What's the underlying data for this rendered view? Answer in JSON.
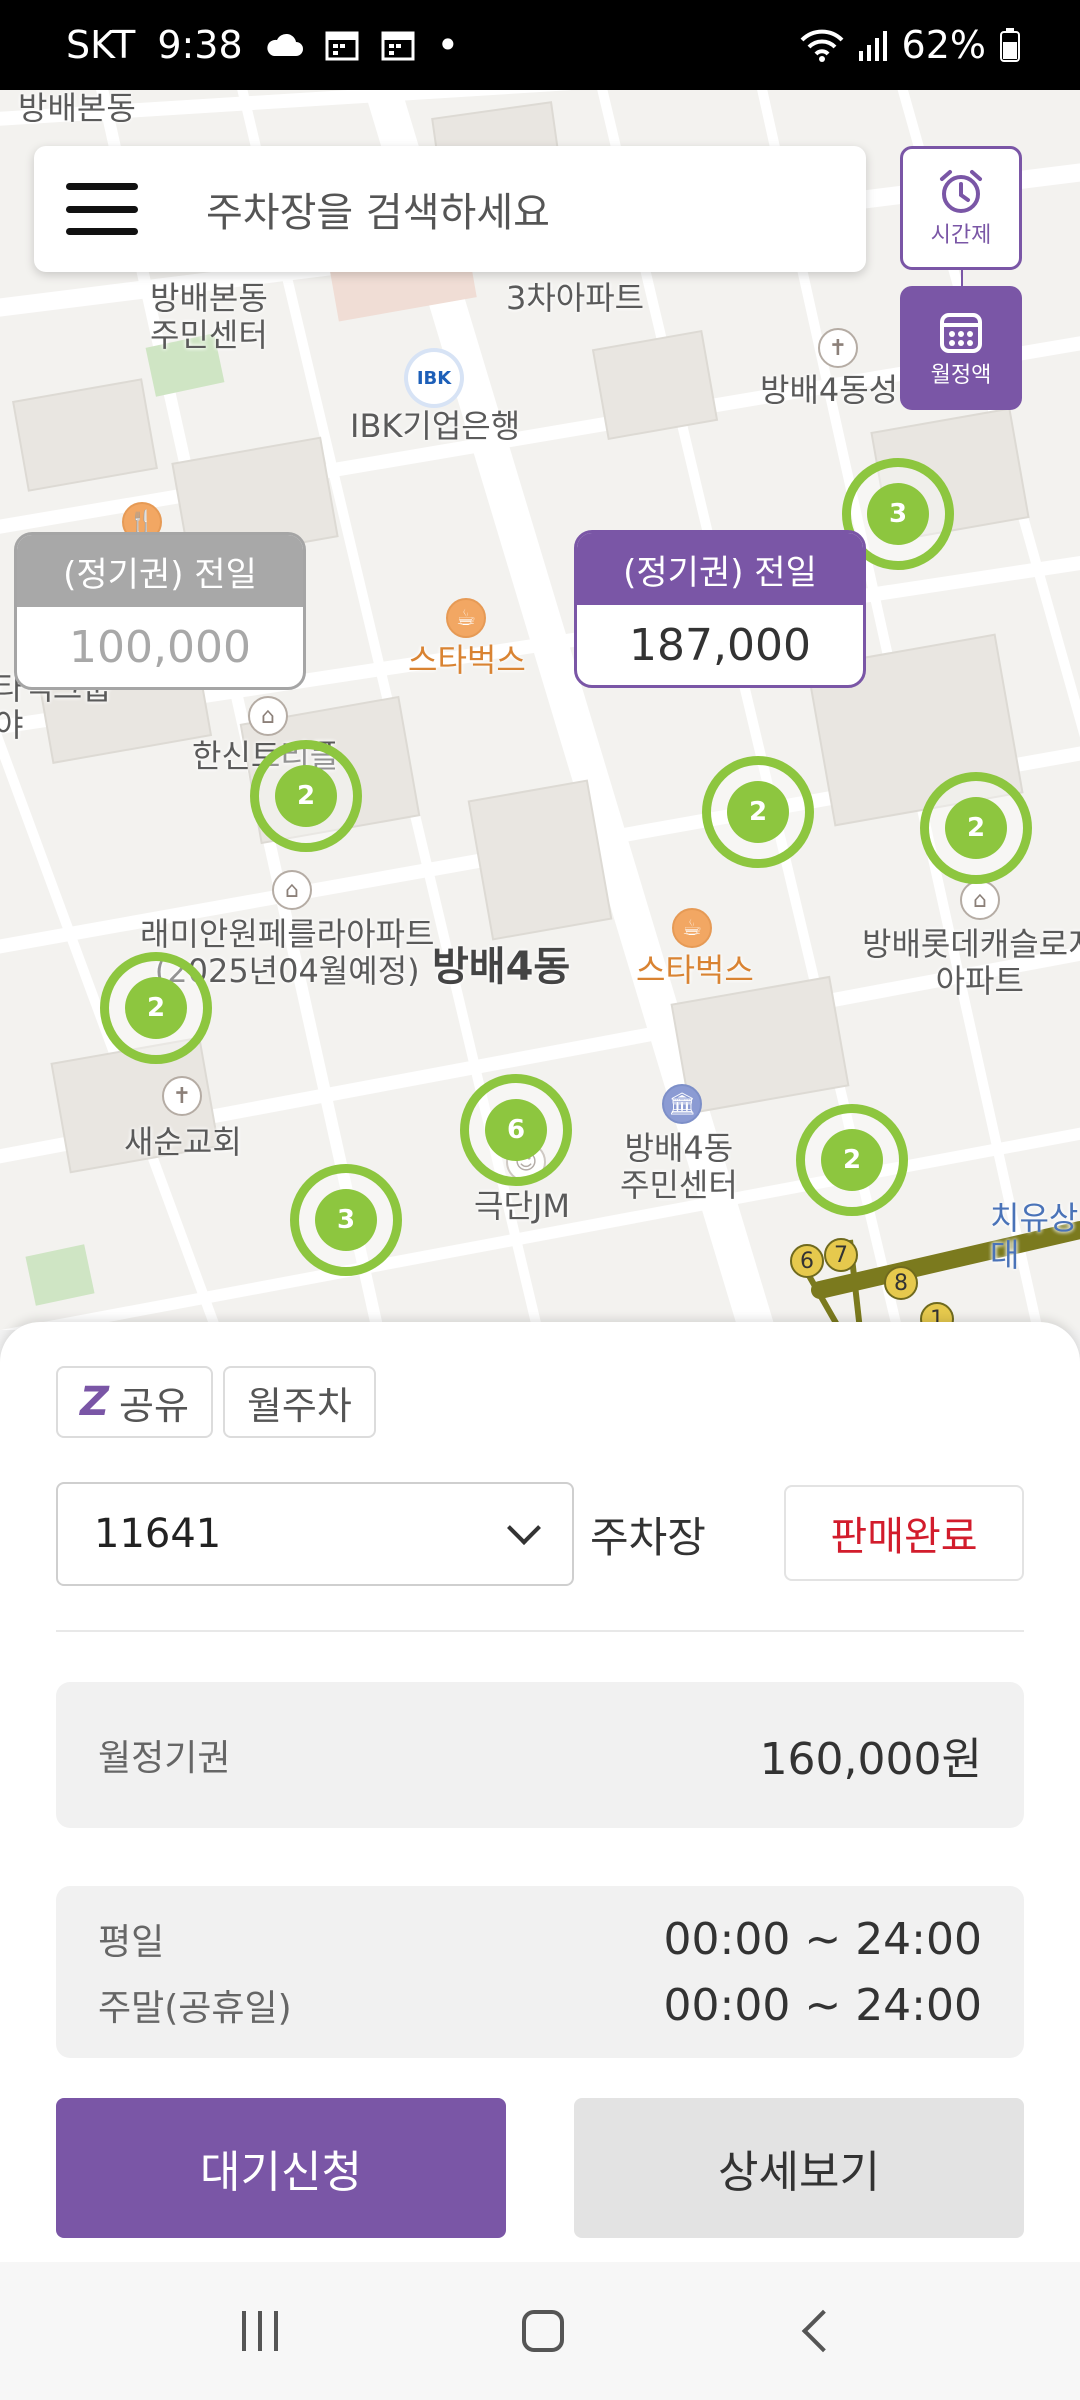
{
  "status_bar": {
    "carrier": "SKT",
    "time": "9:38",
    "dot": "•",
    "battery": "62%",
    "icons": [
      "cloud-icon",
      "calendar-icon",
      "calendar-icon",
      "wifi-icon",
      "signal-icon",
      "battery-icon"
    ]
  },
  "map": {
    "labels": {
      "bangbae_bondong": "방배본동",
      "community_center_top": "방배본동\n주민센터",
      "apt3": "3차아파트",
      "ibk": "IBK기업은행",
      "bangbae4_church": "방배4동성",
      "starbucks_1": "스타벅스",
      "starbucks_2": "스타벅스",
      "hansin": "한신트리플",
      "rami": "래미안원페를라아파트\n(2025년04월예정)",
      "bangbae4": "방배4동",
      "lotte": "방배롯데캐슬로지\n아파트",
      "saesun": "새순교회",
      "theater": "극단JM",
      "community_center_bottom": "방배4동\n주민센터",
      "chiyu": "치유상\n대",
      "group_left": "타넥그룹\n야"
    },
    "clusters": [
      "3",
      "2",
      "2",
      "2",
      "2",
      "6",
      "2",
      "3"
    ],
    "subway_numbers": [
      "6",
      "7",
      "8",
      "1"
    ]
  },
  "price_cards": [
    {
      "header": "(정기권) 전일",
      "value": "100,000",
      "style": "gray"
    },
    {
      "header": "(정기권) 전일",
      "value": "187,000",
      "style": "purple"
    }
  ],
  "search": {
    "placeholder": "주차장을 검색하세요"
  },
  "side_buttons": {
    "time": "시간제",
    "month": "월정액"
  },
  "sheet": {
    "tags": {
      "share": "공유",
      "monthly": "월주차",
      "logo": "Z"
    },
    "lot_select": "11641",
    "lot_label": "주차장",
    "sold_out": "판매완료",
    "monthly_pass_label": "월정기권",
    "monthly_pass_value": "160,000원",
    "weekday_label": "평일",
    "weekday_hours": "00:00 ~ 24:00",
    "weekend_label": "주말(공휴일)",
    "weekend_hours": "00:00 ~ 24:00",
    "wait_button": "대기신청",
    "detail_button": "상세보기"
  },
  "colors": {
    "brand": "#7a56a6",
    "cluster": "#8dc63f",
    "sold_out": "#d21c2c"
  }
}
